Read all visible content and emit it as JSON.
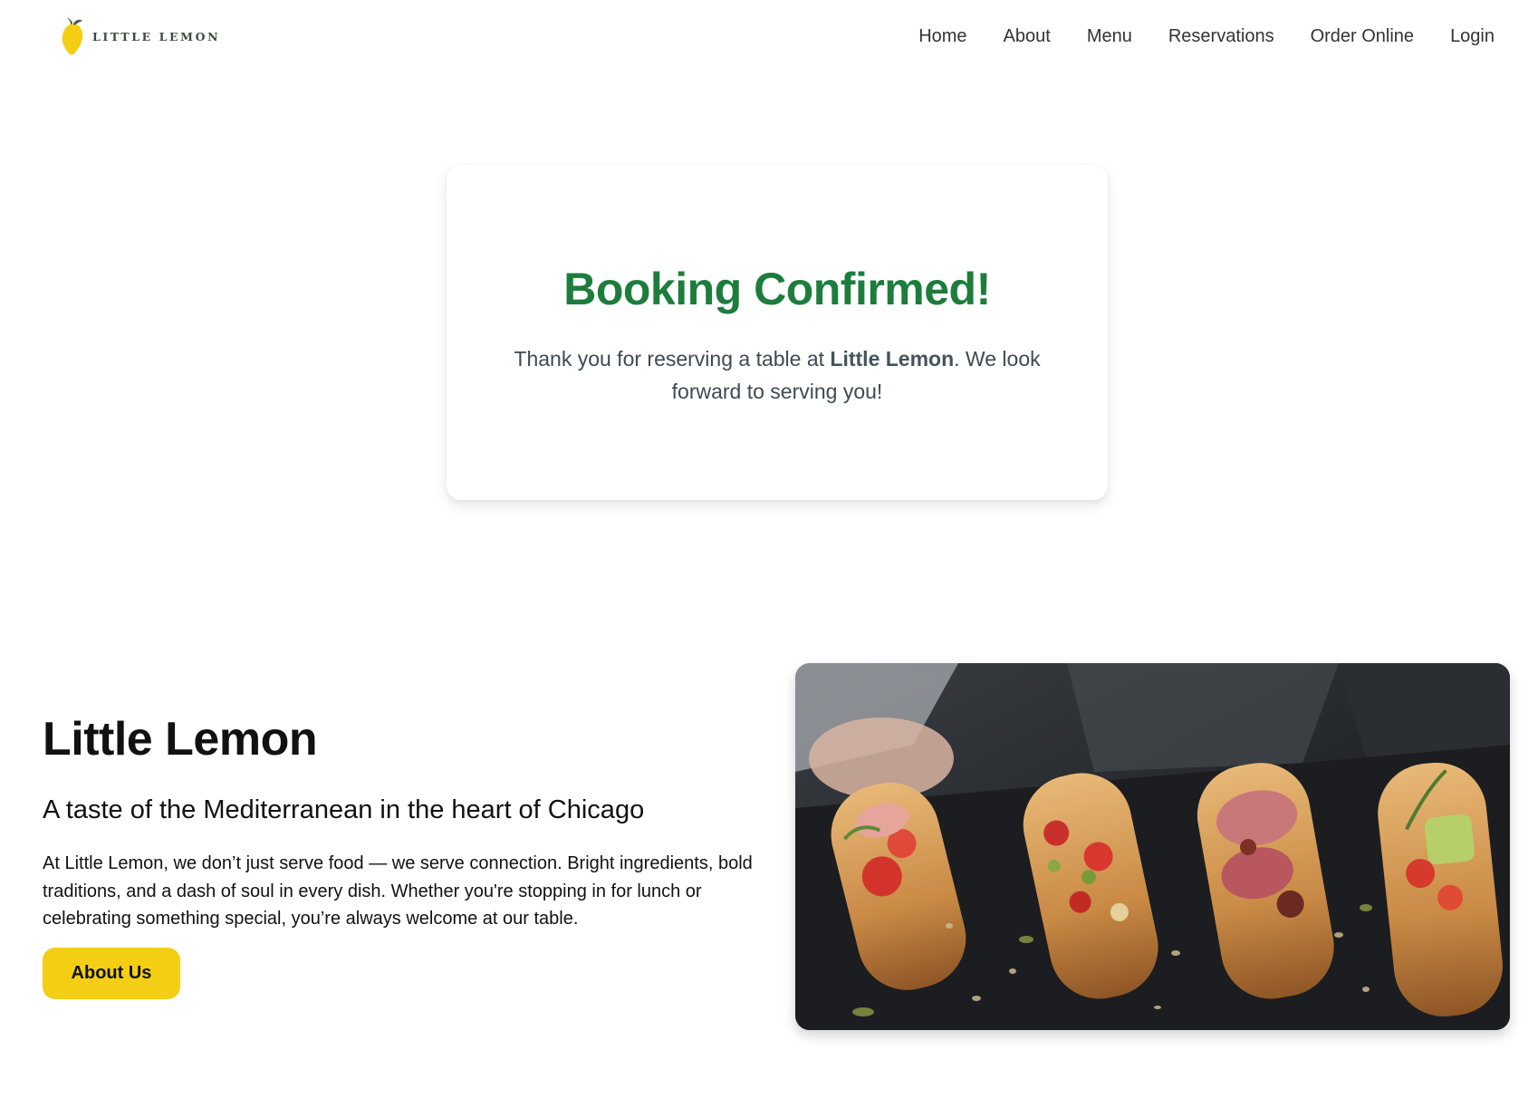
{
  "brand": {
    "name": "LITTLE LEMON",
    "logo_icon": "lemon-icon",
    "accent": "#f4ce14"
  },
  "nav": {
    "items": [
      {
        "label": "Home"
      },
      {
        "label": "About"
      },
      {
        "label": "Menu"
      },
      {
        "label": "Reservations"
      },
      {
        "label": "Order Online"
      },
      {
        "label": "Login"
      }
    ]
  },
  "confirmation": {
    "title": "Booking Confirmed!",
    "message_prefix": "Thank you for reserving a table at ",
    "restaurant": "Little Lemon",
    "message_suffix": ". We look forward to serving you!",
    "title_color": "#1c7d3c"
  },
  "hero": {
    "title": "Little Lemon",
    "subtitle": "A taste of the Mediterranean in the heart of Chicago",
    "description": "At Little Lemon, we don’t just serve food — we serve connection. Bright ingredients, bold traditions, and a dash of soul in every dish. Whether you're stopping in for lunch or celebrating something special, you’re always welcome at our table.",
    "button_label": "About Us",
    "image_subject": "bruschetta-platter-photo"
  }
}
